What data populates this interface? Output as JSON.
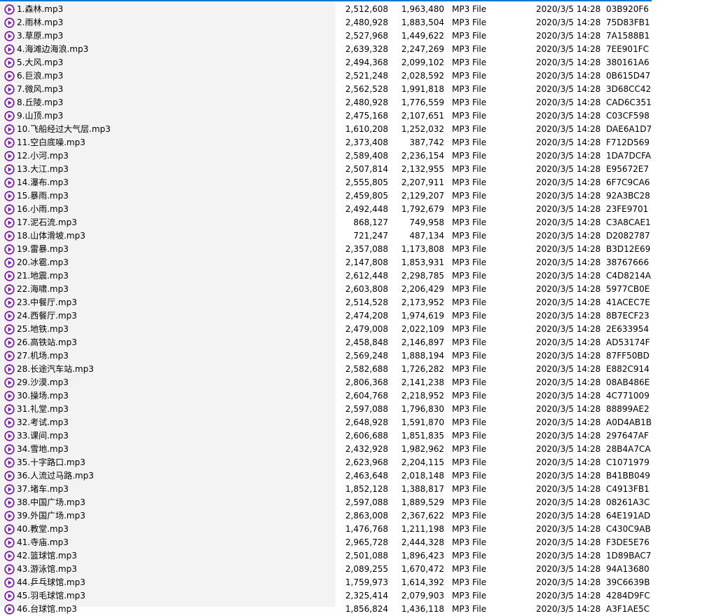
{
  "file_icon": "audio-play-icon",
  "accent_color": "#0078d7",
  "icon_color": "#7b1fa2",
  "files": [
    {
      "name": "1.森林.mp3",
      "size": "2,512,608",
      "packed": "1,963,480",
      "type": "MP3 File",
      "modified": "2020/3/5 14:28",
      "crc": "03B920F6"
    },
    {
      "name": "2.雨林.mp3",
      "size": "2,480,928",
      "packed": "1,883,504",
      "type": "MP3 File",
      "modified": "2020/3/5 14:28",
      "crc": "75D83FB1"
    },
    {
      "name": "3.草原.mp3",
      "size": "2,527,968",
      "packed": "1,449,622",
      "type": "MP3 File",
      "modified": "2020/3/5 14:28",
      "crc": "7A1588B1"
    },
    {
      "name": "4.海滩边海浪.mp3",
      "size": "2,639,328",
      "packed": "2,247,269",
      "type": "MP3 File",
      "modified": "2020/3/5 14:28",
      "crc": "7EE901FC"
    },
    {
      "name": "5.大风.mp3",
      "size": "2,494,368",
      "packed": "2,099,102",
      "type": "MP3 File",
      "modified": "2020/3/5 14:28",
      "crc": "380161A6"
    },
    {
      "name": "6.巨浪.mp3",
      "size": "2,521,248",
      "packed": "2,028,592",
      "type": "MP3 File",
      "modified": "2020/3/5 14:28",
      "crc": "0B615D47"
    },
    {
      "name": "7.微风.mp3",
      "size": "2,562,528",
      "packed": "1,991,818",
      "type": "MP3 File",
      "modified": "2020/3/5 14:28",
      "crc": "3D68CC42"
    },
    {
      "name": "8.丘陵.mp3",
      "size": "2,480,928",
      "packed": "1,776,559",
      "type": "MP3 File",
      "modified": "2020/3/5 14:28",
      "crc": "CAD6C351"
    },
    {
      "name": "9.山顶.mp3",
      "size": "2,475,168",
      "packed": "2,107,651",
      "type": "MP3 File",
      "modified": "2020/3/5 14:28",
      "crc": "C03CF598"
    },
    {
      "name": "10.飞船经过大气层.mp3",
      "size": "1,610,208",
      "packed": "1,252,032",
      "type": "MP3 File",
      "modified": "2020/3/5 14:28",
      "crc": "DAE6A1D7"
    },
    {
      "name": "11.空白底噪.mp3",
      "size": "2,373,408",
      "packed": "387,742",
      "type": "MP3 File",
      "modified": "2020/3/5 14:28",
      "crc": "F712D569"
    },
    {
      "name": "12.小河.mp3",
      "size": "2,589,408",
      "packed": "2,236,154",
      "type": "MP3 File",
      "modified": "2020/3/5 14:28",
      "crc": "1DA7DCFA"
    },
    {
      "name": "13.大江.mp3",
      "size": "2,507,814",
      "packed": "2,132,955",
      "type": "MP3 File",
      "modified": "2020/3/5 14:28",
      "crc": "E95672E7"
    },
    {
      "name": "14.瀑布.mp3",
      "size": "2,555,805",
      "packed": "2,207,911",
      "type": "MP3 File",
      "modified": "2020/3/5 14:28",
      "crc": "6F7C9CA6"
    },
    {
      "name": "15.暴雨.mp3",
      "size": "2,459,805",
      "packed": "2,129,207",
      "type": "MP3 File",
      "modified": "2020/3/5 14:28",
      "crc": "92A3BC28"
    },
    {
      "name": "16.小雨.mp3",
      "size": "2,492,448",
      "packed": "1,792,679",
      "type": "MP3 File",
      "modified": "2020/3/5 14:28",
      "crc": "23FE9701"
    },
    {
      "name": "17.泥石流.mp3",
      "size": "868,127",
      "packed": "749,958",
      "type": "MP3 File",
      "modified": "2020/3/5 14:28",
      "crc": "C3A8CAE1"
    },
    {
      "name": "18.山体滑坡.mp3",
      "size": "721,247",
      "packed": "487,134",
      "type": "MP3 File",
      "modified": "2020/3/5 14:28",
      "crc": "D2082787"
    },
    {
      "name": "19.雷暴.mp3",
      "size": "2,357,088",
      "packed": "1,173,808",
      "type": "MP3 File",
      "modified": "2020/3/5 14:28",
      "crc": "B3D12E69"
    },
    {
      "name": "20.冰雹.mp3",
      "size": "2,147,808",
      "packed": "1,853,931",
      "type": "MP3 File",
      "modified": "2020/3/5 14:28",
      "crc": "38767666"
    },
    {
      "name": "21.地震.mp3",
      "size": "2,612,448",
      "packed": "2,298,785",
      "type": "MP3 File",
      "modified": "2020/3/5 14:28",
      "crc": "C4D8214A"
    },
    {
      "name": "22.海啸.mp3",
      "size": "2,603,808",
      "packed": "2,206,429",
      "type": "MP3 File",
      "modified": "2020/3/5 14:28",
      "crc": "5977CB0E"
    },
    {
      "name": "23.中餐厅.mp3",
      "size": "2,514,528",
      "packed": "2,173,952",
      "type": "MP3 File",
      "modified": "2020/3/5 14:28",
      "crc": "41ACEC7E"
    },
    {
      "name": "24.西餐厅.mp3",
      "size": "2,474,208",
      "packed": "1,974,619",
      "type": "MP3 File",
      "modified": "2020/3/5 14:28",
      "crc": "8B7ECF23"
    },
    {
      "name": "25.地铁.mp3",
      "size": "2,479,008",
      "packed": "2,022,109",
      "type": "MP3 File",
      "modified": "2020/3/5 14:28",
      "crc": "2E633954"
    },
    {
      "name": "26.高铁站.mp3",
      "size": "2,458,848",
      "packed": "2,146,897",
      "type": "MP3 File",
      "modified": "2020/3/5 14:28",
      "crc": "AD53174F"
    },
    {
      "name": "27.机场.mp3",
      "size": "2,569,248",
      "packed": "1,888,194",
      "type": "MP3 File",
      "modified": "2020/3/5 14:28",
      "crc": "87FF50BD"
    },
    {
      "name": "28.长途汽车站.mp3",
      "size": "2,582,688",
      "packed": "1,726,282",
      "type": "MP3 File",
      "modified": "2020/3/5 14:28",
      "crc": "E882C914"
    },
    {
      "name": "29.沙漠.mp3",
      "size": "2,806,368",
      "packed": "2,141,238",
      "type": "MP3 File",
      "modified": "2020/3/5 14:28",
      "crc": "08AB486E"
    },
    {
      "name": "30.操场.mp3",
      "size": "2,604,768",
      "packed": "2,218,952",
      "type": "MP3 File",
      "modified": "2020/3/5 14:28",
      "crc": "4C771009"
    },
    {
      "name": "31.礼堂.mp3",
      "size": "2,597,088",
      "packed": "1,796,830",
      "type": "MP3 File",
      "modified": "2020/3/5 14:28",
      "crc": "88899AE2"
    },
    {
      "name": "32.考试.mp3",
      "size": "2,648,928",
      "packed": "1,591,870",
      "type": "MP3 File",
      "modified": "2020/3/5 14:28",
      "crc": "A0D4AB1B"
    },
    {
      "name": "33.课间.mp3",
      "size": "2,606,688",
      "packed": "1,851,835",
      "type": "MP3 File",
      "modified": "2020/3/5 14:28",
      "crc": "297647AF"
    },
    {
      "name": "34.雪地.mp3",
      "size": "2,432,928",
      "packed": "1,982,962",
      "type": "MP3 File",
      "modified": "2020/3/5 14:28",
      "crc": "28B4A7CA"
    },
    {
      "name": "35.十字路口.mp3",
      "size": "2,623,968",
      "packed": "2,204,115",
      "type": "MP3 File",
      "modified": "2020/3/5 14:28",
      "crc": "C1071979"
    },
    {
      "name": "36.人流过马路.mp3",
      "size": "2,463,648",
      "packed": "2,018,148",
      "type": "MP3 File",
      "modified": "2020/3/5 14:28",
      "crc": "B41BB049"
    },
    {
      "name": "37.堵车.mp3",
      "size": "1,852,128",
      "packed": "1,388,817",
      "type": "MP3 File",
      "modified": "2020/3/5 14:28",
      "crc": "C4913FB1"
    },
    {
      "name": "38.中国广场.mp3",
      "size": "2,597,088",
      "packed": "1,889,529",
      "type": "MP3 File",
      "modified": "2020/3/5 14:28",
      "crc": "08261A3C"
    },
    {
      "name": "39.外国广场.mp3",
      "size": "2,863,008",
      "packed": "2,367,622",
      "type": "MP3 File",
      "modified": "2020/3/5 14:28",
      "crc": "64E191AD"
    },
    {
      "name": "40.教堂.mp3",
      "size": "1,476,768",
      "packed": "1,211,198",
      "type": "MP3 File",
      "modified": "2020/3/5 14:28",
      "crc": "C430C9AB"
    },
    {
      "name": "41.寺庙.mp3",
      "size": "2,965,728",
      "packed": "2,444,328",
      "type": "MP3 File",
      "modified": "2020/3/5 14:28",
      "crc": "F3DE5E76"
    },
    {
      "name": "42.篮球馆.mp3",
      "size": "2,501,088",
      "packed": "1,896,423",
      "type": "MP3 File",
      "modified": "2020/3/5 14:28",
      "crc": "1D89BAC7"
    },
    {
      "name": "43.游泳馆.mp3",
      "size": "2,089,255",
      "packed": "1,670,472",
      "type": "MP3 File",
      "modified": "2020/3/5 14:28",
      "crc": "94A13680"
    },
    {
      "name": "44.乒乓球馆.mp3",
      "size": "1,759,973",
      "packed": "1,614,392",
      "type": "MP3 File",
      "modified": "2020/3/5 14:28",
      "crc": "39C6639B"
    },
    {
      "name": "45.羽毛球馆.mp3",
      "size": "2,325,414",
      "packed": "2,079,903",
      "type": "MP3 File",
      "modified": "2020/3/5 14:28",
      "crc": "4284D9FC"
    },
    {
      "name": "46.台球馆.mp3",
      "size": "1,856,824",
      "packed": "1,436,118",
      "type": "MP3 File",
      "modified": "2020/3/5 14:28",
      "crc": "A3F1AE5C"
    }
  ]
}
